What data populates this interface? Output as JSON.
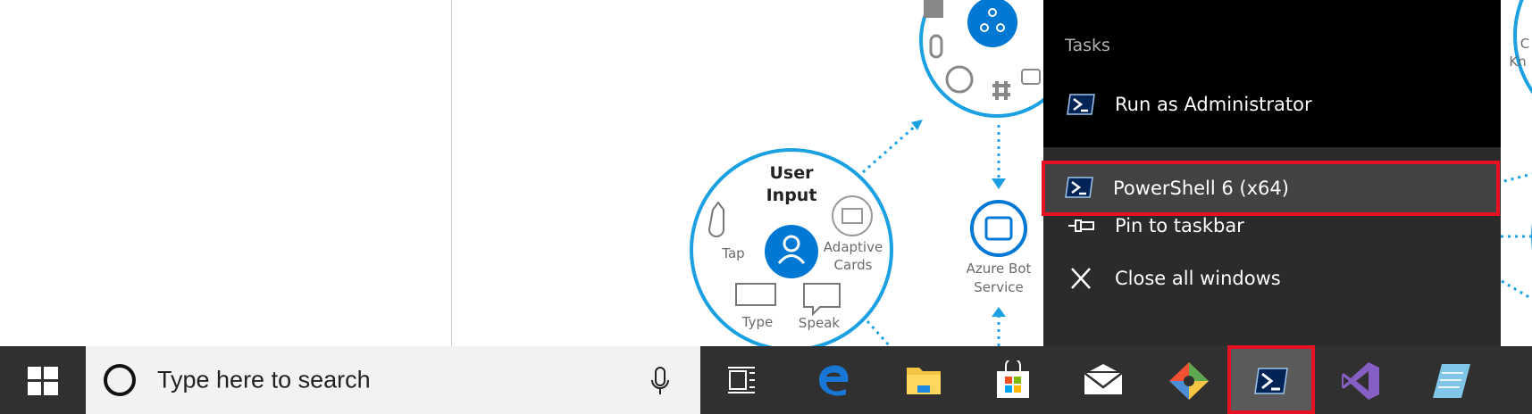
{
  "diagram": {
    "user_input_title_1": "User",
    "user_input_title_2": "Input",
    "tap": "Tap",
    "adaptive_1": "Adaptive",
    "adaptive_2": "Cards",
    "type": "Type",
    "speak": "Speak",
    "bot_1": "Azure Bot",
    "bot_2": "Service",
    "right_edge_1": "C",
    "right_edge_2": "Kn"
  },
  "jumplist": {
    "header": "Tasks",
    "run_admin": "Run as Administrator",
    "powershell": "PowerShell 6 (x64)",
    "pin": "Pin to taskbar",
    "close_all": "Close all windows"
  },
  "taskbar": {
    "search_placeholder": "Type here to search",
    "apps": [
      "task-view-icon",
      "edge-icon",
      "file-explorer-icon",
      "store-icon",
      "mail-icon",
      "git-icon",
      "powershell-icon",
      "visual-studio-icon",
      "notepad-icon"
    ]
  },
  "colors": {
    "accent_blue": "#0078d4",
    "diagram_cyan": "#1ba1e2",
    "highlight_red": "#e81123"
  }
}
